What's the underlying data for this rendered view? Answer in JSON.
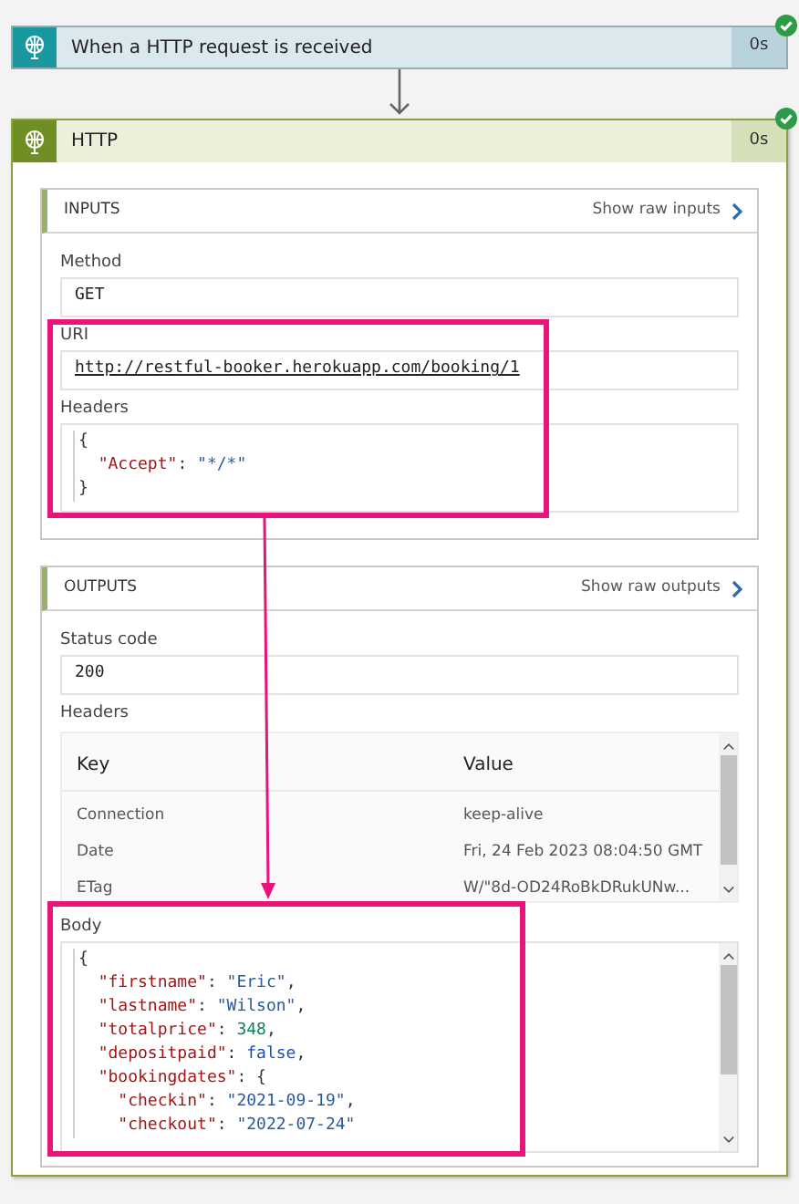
{
  "trigger": {
    "title": "When a HTTP request is received",
    "duration": "0s",
    "succeeded": true
  },
  "action": {
    "title": "HTTP",
    "duration": "0s",
    "succeeded": true,
    "inputs": {
      "heading": "INPUTS",
      "raw_link": "Show raw inputs",
      "method": {
        "label": "Method",
        "value": "GET"
      },
      "uri": {
        "label": "URI",
        "value": "http://restful-booker.herokuapp.com/booking/1"
      },
      "headers": {
        "label": "Headers",
        "code": [
          [
            {
              "kind": "punct",
              "text": "{"
            }
          ],
          [
            {
              "kind": "key",
              "text": "  \"Accept\""
            },
            {
              "kind": "punct",
              "text": ": "
            },
            {
              "kind": "string",
              "text": "\"*/*\""
            }
          ],
          [
            {
              "kind": "punct",
              "text": "}"
            }
          ]
        ]
      }
    },
    "outputs": {
      "heading": "OUTPUTS",
      "raw_link": "Show raw outputs",
      "status": {
        "label": "Status code",
        "value": "200"
      },
      "headers": {
        "label": "Headers",
        "columns": [
          "Key",
          "Value"
        ],
        "rows": [
          [
            "Connection",
            "keep-alive"
          ],
          [
            "Date",
            "Fri, 24 Feb 2023 08:04:50 GMT"
          ],
          [
            "ETag",
            "W/\"8d-OD24RoBkDRukUNw..."
          ]
        ]
      },
      "body": {
        "label": "Body",
        "code": [
          [
            {
              "kind": "punct",
              "text": "{"
            }
          ],
          [
            {
              "kind": "key",
              "text": "  \"firstname\""
            },
            {
              "kind": "punct",
              "text": ": "
            },
            {
              "kind": "string",
              "text": "\"Eric\""
            },
            {
              "kind": "punct",
              "text": ","
            }
          ],
          [
            {
              "kind": "key",
              "text": "  \"lastname\""
            },
            {
              "kind": "punct",
              "text": ": "
            },
            {
              "kind": "string",
              "text": "\"Wilson\""
            },
            {
              "kind": "punct",
              "text": ","
            }
          ],
          [
            {
              "kind": "key",
              "text": "  \"totalprice\""
            },
            {
              "kind": "punct",
              "text": ": "
            },
            {
              "kind": "number",
              "text": "348"
            },
            {
              "kind": "punct",
              "text": ","
            }
          ],
          [
            {
              "kind": "key",
              "text": "  \"depositpaid\""
            },
            {
              "kind": "punct",
              "text": ": "
            },
            {
              "kind": "bool",
              "text": "false"
            },
            {
              "kind": "punct",
              "text": ","
            }
          ],
          [
            {
              "kind": "key",
              "text": "  \"bookingdates\""
            },
            {
              "kind": "punct",
              "text": ": {"
            }
          ],
          [
            {
              "kind": "key",
              "text": "    \"checkin\""
            },
            {
              "kind": "punct",
              "text": ": "
            },
            {
              "kind": "string",
              "text": "\"2021-09-19\""
            },
            {
              "kind": "punct",
              "text": ","
            }
          ],
          [
            {
              "kind": "key",
              "text": "    \"checkout\""
            },
            {
              "kind": "punct",
              "text": ": "
            },
            {
              "kind": "string",
              "text": "\"2022-07-24\""
            }
          ]
        ]
      }
    }
  }
}
